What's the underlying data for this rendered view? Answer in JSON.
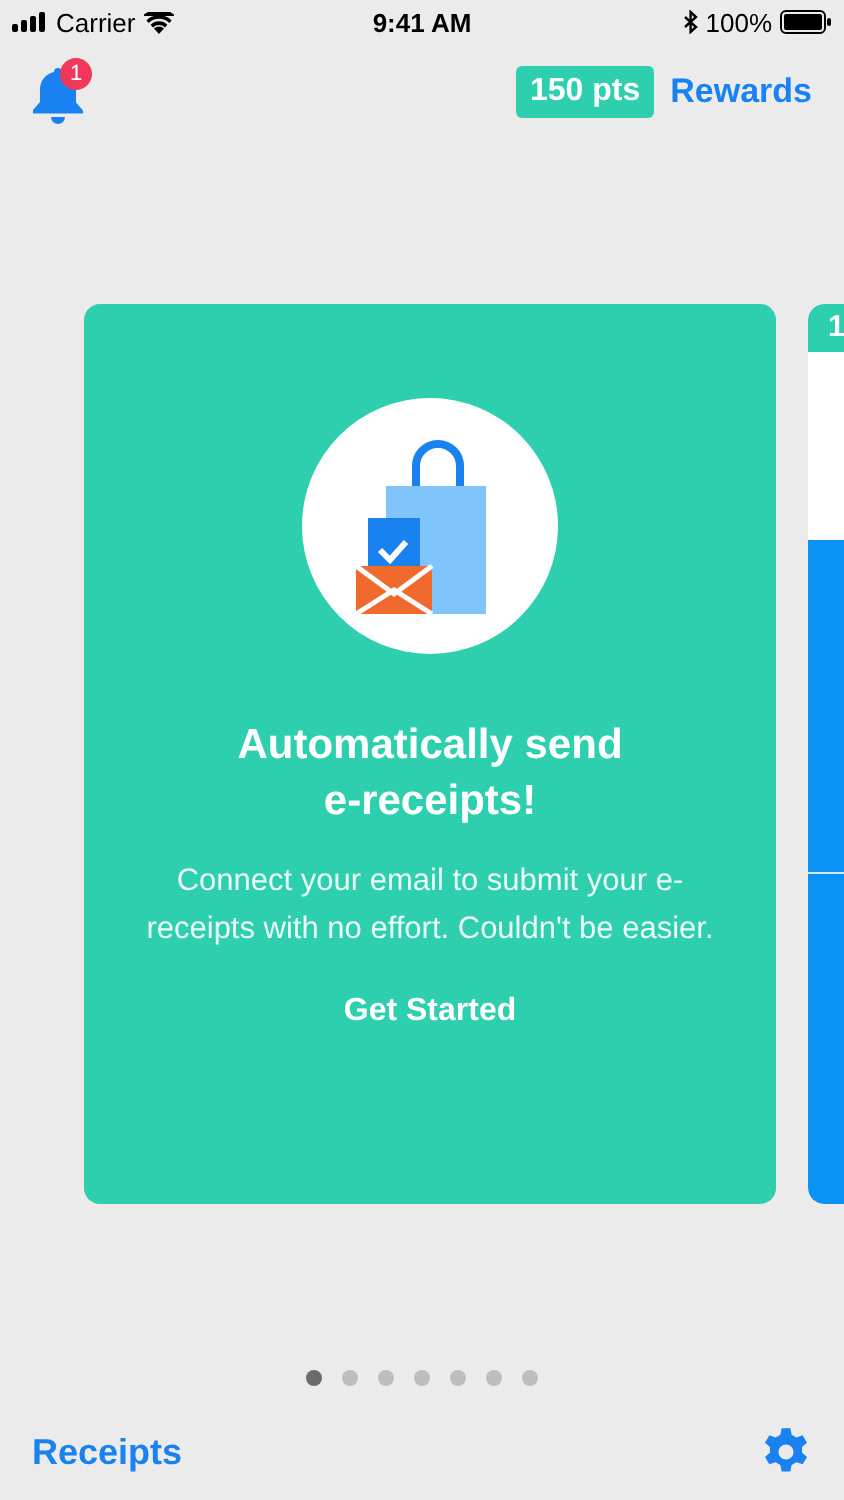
{
  "status_bar": {
    "carrier": "Carrier",
    "time": "9:41 AM",
    "battery": "100%"
  },
  "header": {
    "notification_badge": "1",
    "points": "150 pts",
    "rewards_link": "Rewards"
  },
  "cards": [
    {
      "kind": "promo",
      "title": "Automatically send e-receipts!",
      "body": "Connect your email to submit your e-receipts with no effort. Couldn't be easier.",
      "action": "Get Started"
    },
    {
      "kind": "peek",
      "header": "1"
    }
  ],
  "pager": {
    "dots": [
      {
        "selected": true
      },
      {
        "selected": false
      },
      {
        "selected": false
      },
      {
        "selected": false
      },
      {
        "selected": false
      },
      {
        "selected": false
      },
      {
        "selected": false
      }
    ]
  },
  "footer": {
    "receipts_link": "Receipts"
  }
}
